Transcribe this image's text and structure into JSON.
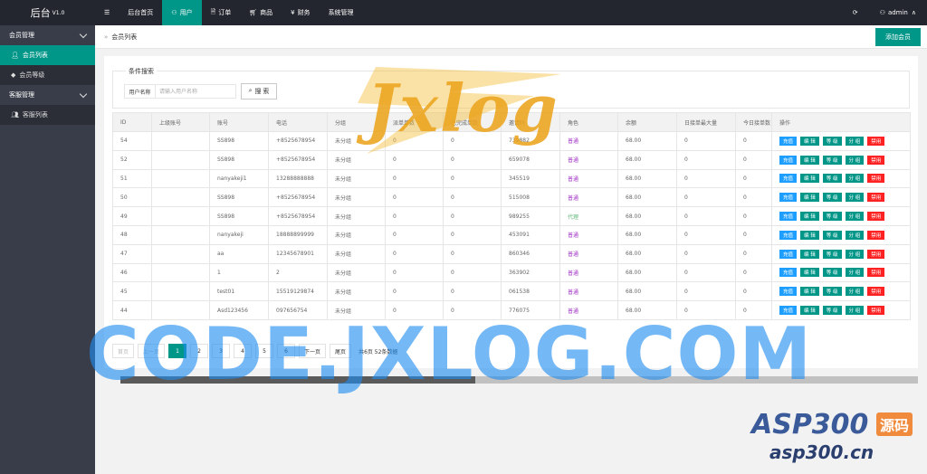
{
  "logo": {
    "title": "后台",
    "version": "V1.0"
  },
  "sidebar": {
    "groups": [
      {
        "label": "会员管理",
        "children": [
          {
            "label": "会员列表",
            "icon": "user-icon",
            "active": true
          },
          {
            "label": "会员等级",
            "icon": "diamond-icon",
            "active": false
          }
        ]
      },
      {
        "label": "客服管理",
        "children": [
          {
            "label": "客服列表",
            "icon": "users-icon",
            "active": false
          }
        ]
      }
    ]
  },
  "topnav": {
    "menu_icon": "menu-icon",
    "items": [
      {
        "label": "后台首页",
        "icon": ""
      },
      {
        "label": "用户",
        "icon": "user-icon",
        "active": true
      },
      {
        "label": "订单",
        "icon": "document-icon"
      },
      {
        "label": "商品",
        "icon": "cart-icon"
      },
      {
        "label": "财务",
        "icon": "yen-icon"
      },
      {
        "label": "系统管理",
        "icon": ""
      }
    ],
    "refresh_icon": "refresh-icon",
    "user": "admin"
  },
  "breadcrumb": {
    "current": "会员列表"
  },
  "add_button": "添加会员",
  "search": {
    "legend": "条件搜索",
    "label": "用户名称",
    "placeholder": "请输入用户名称",
    "button": "搜 索"
  },
  "table": {
    "headers": [
      "ID",
      "上级账号",
      "账号",
      "电话",
      "分组",
      "派单单数",
      "已完成单数",
      "邀请码",
      "角色",
      "余额",
      "日接单最大量",
      "今日接单数",
      "操作"
    ],
    "rows": [
      {
        "id": "54",
        "parent": "",
        "account": "SS898",
        "phone": "+8525678954",
        "group": "未分组",
        "dispatched": "0",
        "done": "0",
        "invite": "739882",
        "role": "普通",
        "balance": "68.00",
        "daymax": "0",
        "today": "0"
      },
      {
        "id": "52",
        "parent": "",
        "account": "SS898",
        "phone": "+8525678954",
        "group": "未分组",
        "dispatched": "0",
        "done": "0",
        "invite": "659078",
        "role": "普通",
        "balance": "68.00",
        "daymax": "0",
        "today": "0"
      },
      {
        "id": "51",
        "parent": "",
        "account": "nanyakeji1",
        "phone": "13288888888",
        "group": "未分组",
        "dispatched": "0",
        "done": "0",
        "invite": "345519",
        "role": "普通",
        "balance": "68.00",
        "daymax": "0",
        "today": "0"
      },
      {
        "id": "50",
        "parent": "",
        "account": "SS898",
        "phone": "+8525678954",
        "group": "未分组",
        "dispatched": "0",
        "done": "0",
        "invite": "515008",
        "role": "普通",
        "balance": "68.00",
        "daymax": "0",
        "today": "0"
      },
      {
        "id": "49",
        "parent": "",
        "account": "SS898",
        "phone": "+8525678954",
        "group": "未分组",
        "dispatched": "0",
        "done": "0",
        "invite": "989255",
        "role": "代理",
        "balance": "68.00",
        "daymax": "0",
        "today": "0"
      },
      {
        "id": "48",
        "parent": "",
        "account": "nanyakeji",
        "phone": "18888899999",
        "group": "未分组",
        "dispatched": "0",
        "done": "0",
        "invite": "453091",
        "role": "普通",
        "balance": "68.00",
        "daymax": "0",
        "today": "0"
      },
      {
        "id": "47",
        "parent": "",
        "account": "aa",
        "phone": "12345678901",
        "group": "未分组",
        "dispatched": "0",
        "done": "0",
        "invite": "860346",
        "role": "普通",
        "balance": "68.00",
        "daymax": "0",
        "today": "0"
      },
      {
        "id": "46",
        "parent": "",
        "account": "1",
        "phone": "2",
        "group": "未分组",
        "dispatched": "0",
        "done": "0",
        "invite": "363902",
        "role": "普通",
        "balance": "68.00",
        "daymax": "0",
        "today": "0"
      },
      {
        "id": "45",
        "parent": "",
        "account": "test01",
        "phone": "15519129874",
        "group": "未分组",
        "dispatched": "0",
        "done": "0",
        "invite": "061538",
        "role": "普通",
        "balance": "68.00",
        "daymax": "0",
        "today": "0"
      },
      {
        "id": "44",
        "parent": "",
        "account": "Asd123456",
        "phone": "097656754",
        "group": "未分组",
        "dispatched": "0",
        "done": "0",
        "invite": "776075",
        "role": "普通",
        "balance": "68.00",
        "daymax": "0",
        "today": "0"
      }
    ],
    "actions": [
      "充值",
      "编 辑",
      "等 级",
      "分 组",
      "禁用"
    ]
  },
  "pagination": {
    "first": "首页",
    "prev": "上一页",
    "pages": [
      "1",
      "2",
      "3",
      "4",
      "5",
      "6"
    ],
    "current": "1",
    "next": "下一页",
    "last": "尾页",
    "info": "共6页 52条数据"
  },
  "watermarks": {
    "jxlog": "Jxlog",
    "code": "CODE.JXLOG.COM",
    "asp": "ASP300",
    "asp_tag": "源码",
    "asp_url": "asp300.cn"
  },
  "colors": {
    "accent": "#009688",
    "sidebar": "#393D49",
    "topbar": "#23262E",
    "blue": "#1E9FFF",
    "red": "#FF2222"
  }
}
